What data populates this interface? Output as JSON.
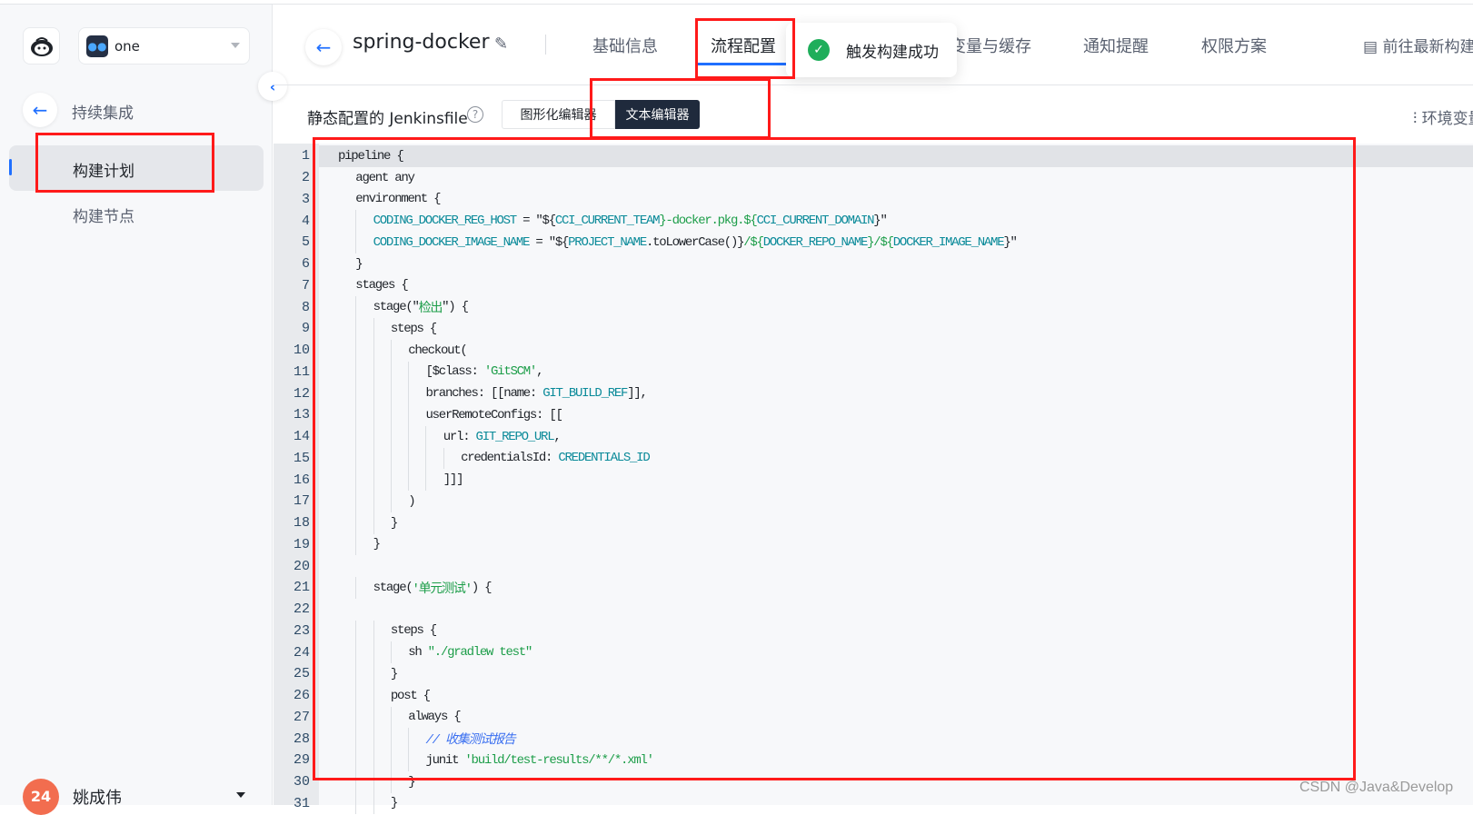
{
  "sidebar": {
    "project": "one",
    "back_label": "持续集成",
    "items": [
      {
        "label": "构建计划",
        "active": true
      },
      {
        "label": "构建节点",
        "active": false
      }
    ],
    "user": {
      "avatar_text": "24",
      "name": "姚成伟"
    }
  },
  "header": {
    "title": "spring-docker",
    "tabs": [
      {
        "label": "基础信息"
      },
      {
        "label": "流程配置",
        "active": true
      },
      {
        "label": "变量与缓存"
      },
      {
        "label": "通知提醒"
      },
      {
        "label": "权限方案"
      }
    ],
    "goto_latest": "前往最新构建"
  },
  "toast": {
    "message": "触发构建成功",
    "status_color": "#1fae5b"
  },
  "toolbar": {
    "label": "静态配置的 Jenkinsfile",
    "graphic_editor": "图形化编辑器",
    "text_editor": "文本编辑器",
    "env_vars": "环境变量"
  },
  "colors": {
    "accent": "#1f6fff",
    "annotation": "#ff1a1a"
  },
  "code": [
    {
      "i": 0,
      "s": [
        [
          "t",
          "pipeline {"
        ]
      ]
    },
    {
      "i": 1,
      "s": [
        [
          "t",
          "agent any"
        ]
      ]
    },
    {
      "i": 1,
      "s": [
        [
          "t",
          "environment {"
        ]
      ]
    },
    {
      "i": 2,
      "s": [
        [
          "v",
          "CODING_DOCKER_REG_HOST"
        ],
        [
          "t",
          " = \"${"
        ],
        [
          "v",
          "CCI_CURRENT_TEAM"
        ],
        [
          "s",
          "}-docker.pkg.${"
        ],
        [
          "v",
          "CCI_CURRENT_DOMAIN"
        ],
        [
          "t",
          "}\""
        ]
      ]
    },
    {
      "i": 2,
      "s": [
        [
          "v",
          "CODING_DOCKER_IMAGE_NAME"
        ],
        [
          "t",
          " = \"${"
        ],
        [
          "v",
          "PROJECT_NAME"
        ],
        [
          "t",
          ".toLowerCase()}"
        ],
        [
          "s",
          "/${"
        ],
        [
          "v",
          "DOCKER_REPO_NAME"
        ],
        [
          "s",
          "}/${"
        ],
        [
          "v",
          "DOCKER_IMAGE_NAME"
        ],
        [
          "t",
          "}\""
        ]
      ]
    },
    {
      "i": 1,
      "s": [
        [
          "t",
          "}"
        ]
      ]
    },
    {
      "i": 1,
      "s": [
        [
          "t",
          "stages {"
        ]
      ]
    },
    {
      "i": 2,
      "s": [
        [
          "t",
          "stage(\""
        ],
        [
          "s",
          "检出"
        ],
        [
          "t",
          "\") {"
        ]
      ]
    },
    {
      "i": 3,
      "s": [
        [
          "t",
          "steps {"
        ]
      ]
    },
    {
      "i": 4,
      "s": [
        [
          "t",
          "checkout("
        ]
      ]
    },
    {
      "i": 5,
      "s": [
        [
          "t",
          "[$class: "
        ],
        [
          "s",
          "'GitSCM'"
        ],
        [
          "t",
          ","
        ]
      ]
    },
    {
      "i": 5,
      "s": [
        [
          "t",
          "branches: [[name: "
        ],
        [
          "v",
          "GIT_BUILD_REF"
        ],
        [
          "t",
          "]],"
        ]
      ]
    },
    {
      "i": 5,
      "s": [
        [
          "t",
          "userRemoteConfigs: [["
        ]
      ]
    },
    {
      "i": 6,
      "s": [
        [
          "t",
          "url: "
        ],
        [
          "v",
          "GIT_REPO_URL"
        ],
        [
          "t",
          ","
        ]
      ]
    },
    {
      "i": 7,
      "s": [
        [
          "t",
          "credentialsId: "
        ],
        [
          "v",
          "CREDENTIALS_ID"
        ]
      ]
    },
    {
      "i": 6,
      "s": [
        [
          "t",
          "]]]"
        ]
      ]
    },
    {
      "i": 4,
      "s": [
        [
          "t",
          ")"
        ]
      ]
    },
    {
      "i": 3,
      "s": [
        [
          "t",
          "}"
        ]
      ]
    },
    {
      "i": 2,
      "s": [
        [
          "t",
          "}"
        ]
      ]
    },
    {
      "i": 0,
      "s": []
    },
    {
      "i": 2,
      "s": [
        [
          "t",
          "stage("
        ],
        [
          "s",
          "'单元测试'"
        ],
        [
          "t",
          ") {"
        ]
      ]
    },
    {
      "i": 0,
      "s": []
    },
    {
      "i": 3,
      "s": [
        [
          "t",
          "steps {"
        ]
      ]
    },
    {
      "i": 4,
      "s": [
        [
          "t",
          "sh "
        ],
        [
          "s",
          "\"./gradlew test\""
        ]
      ]
    },
    {
      "i": 3,
      "s": [
        [
          "t",
          "}"
        ]
      ]
    },
    {
      "i": 3,
      "s": [
        [
          "t",
          "post {"
        ]
      ]
    },
    {
      "i": 4,
      "s": [
        [
          "t",
          "always {"
        ]
      ]
    },
    {
      "i": 5,
      "s": [
        [
          "c",
          "// 收集测试报告"
        ]
      ]
    },
    {
      "i": 5,
      "s": [
        [
          "t",
          "junit "
        ],
        [
          "s",
          "'build/test-results/**/*.xml'"
        ]
      ]
    },
    {
      "i": 4,
      "s": [
        [
          "t",
          "}"
        ]
      ]
    },
    {
      "i": 3,
      "s": [
        [
          "t",
          "}"
        ]
      ]
    }
  ],
  "watermark": "CSDN @Java&Develop"
}
